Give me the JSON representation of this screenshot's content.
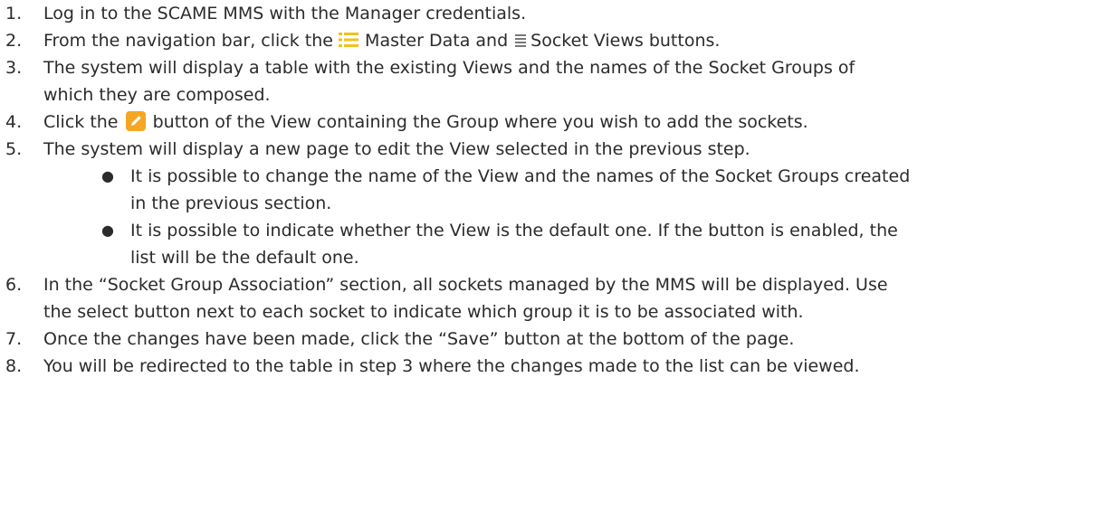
{
  "steps": [
    {
      "num": "1.",
      "text": "Log in to the SCAME MMS with the Manager credentials."
    },
    {
      "num": "2.",
      "pre": "From the navigation bar, click the",
      "mid": "Master Data and",
      "post": "Socket Views buttons.",
      "icon_a": "list-icon",
      "icon_b": "lines-icon"
    },
    {
      "num": "3.",
      "line1": "The system will display a table with the existing Views and the names of the Socket Groups of",
      "line2": "which they are composed."
    },
    {
      "num": "4.",
      "pre": "Click the",
      "post": "button of the View containing the Group where you wish to add the sockets.",
      "icon": "edit-icon"
    },
    {
      "num": "5.",
      "text": "The system will display a new page to edit the View selected in the previous step.",
      "bullets": [
        {
          "line1": "It is possible to change the name of the View and the names of the Socket Groups created",
          "line2": "in the previous section."
        },
        {
          "line1": "It is possible to indicate whether the View is the default one. If the button is enabled, the",
          "line2": "list will be the default one."
        }
      ]
    },
    {
      "num": "6.",
      "line1": "In the “Socket Group Association” section, all sockets managed by the MMS will be displayed. Use",
      "line2": "the select button next to each socket to indicate which group it is to be associated with."
    },
    {
      "num": "7.",
      "text": "Once the changes have been made, click the “Save” button at the bottom of the page."
    },
    {
      "num": "8.",
      "text": "You will be redirected to the table in step 3 where the changes made to the list can be viewed."
    }
  ],
  "colors": {
    "text": "#2b2b2b",
    "list_icon": "#f1c21b",
    "lines_icon": "#777777",
    "edit_icon": "#f5a623"
  }
}
